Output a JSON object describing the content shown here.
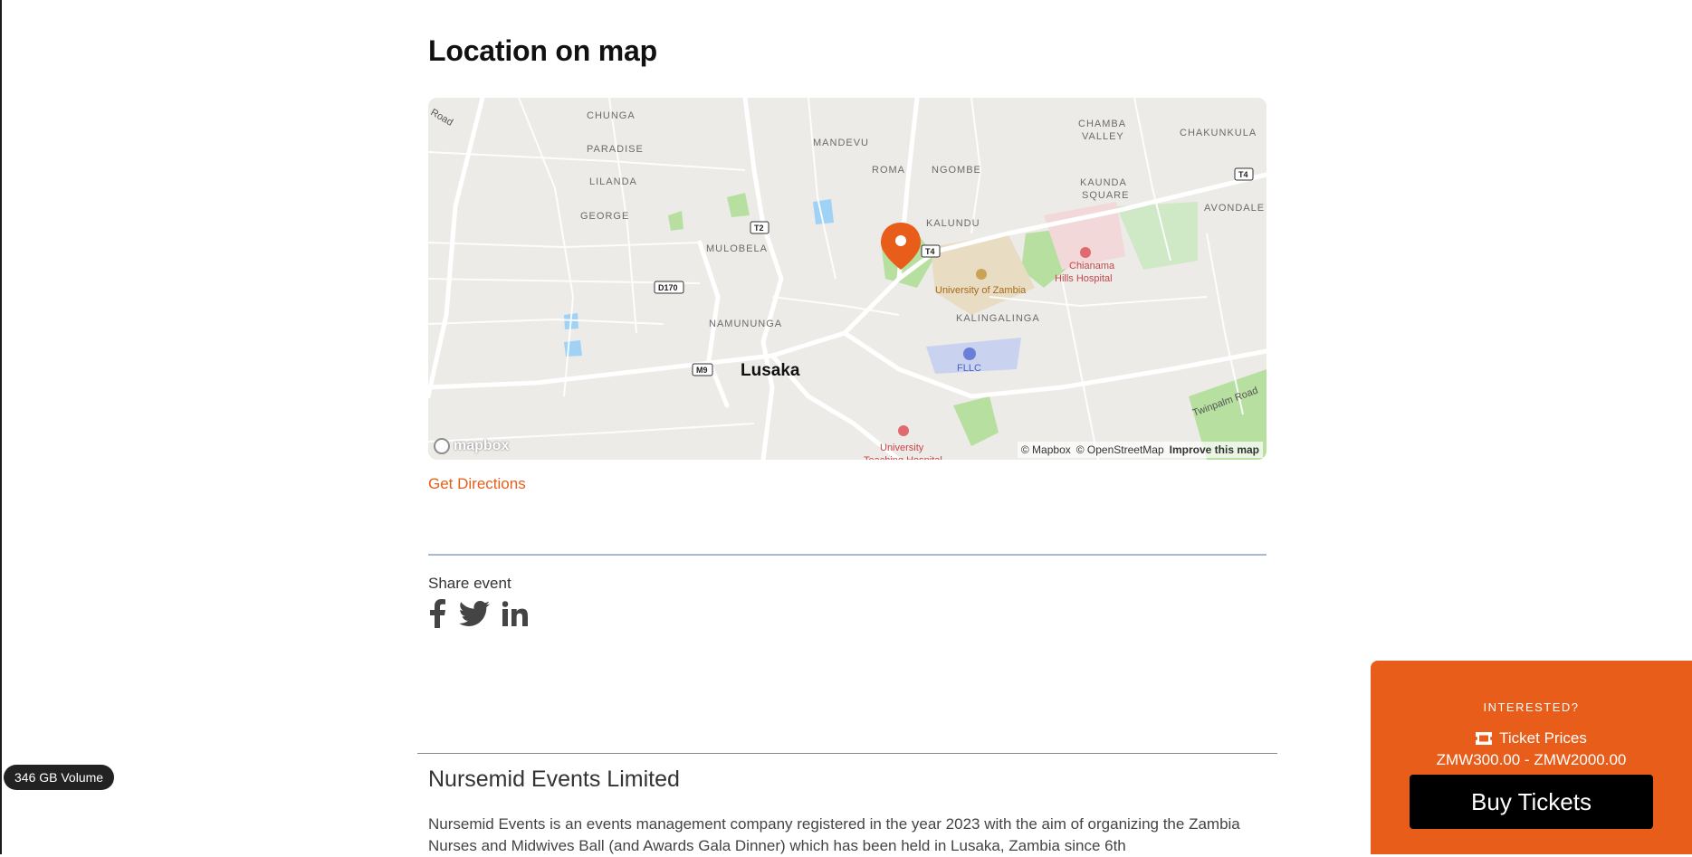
{
  "location": {
    "title": "Location on map",
    "directions_label": "Get Directions"
  },
  "map": {
    "city_label": "Lusaka",
    "places": [
      "CHUNGA",
      "PARADISE",
      "LILANDA",
      "GEORGE",
      "MANDEVU",
      "ROMA",
      "NGOMBE",
      "CHAMBA VALLEY",
      "CHAKUNKULA",
      "KAUNDA SQUARE",
      "AVONDALE",
      "KALUNDU",
      "MULOBELA",
      "NAMUNUNGA",
      "KALINGALINGA",
      "University of Zambia",
      "Chianama Hills Hospital",
      "FLLC",
      "University Teaching Hospital",
      "Twinpalm Road",
      "Road"
    ],
    "road_shields": [
      "T2",
      "D170",
      "M9",
      "T4",
      "T4"
    ],
    "attribution_mapbox": "© Mapbox",
    "attribution_osm": "© OpenStreetMap",
    "improve_label": "Improve this map",
    "logo_text": "mapbox",
    "marker_color": "#e85d1a"
  },
  "share": {
    "label": "Share event",
    "icons": [
      "facebook-icon",
      "twitter-icon",
      "linkedin-icon"
    ]
  },
  "organizer": {
    "name": "Nursemid Events Limited",
    "description": "Nursemid Events is an events management company registered in the year 2023 with the aim of organizing the Zambia Nurses and Midwives Ball (and Awards Gala Dinner) which has been held in Lusaka, Zambia since 6th"
  },
  "system": {
    "volume_badge": "346 GB Volume"
  },
  "tickets": {
    "interested_label": "INTERESTED?",
    "prices_label": "Ticket Prices",
    "price_range": "ZMW300.00 - ZMW2000.00",
    "buy_label": "Buy Tickets",
    "accent_color": "#e85d1a"
  }
}
